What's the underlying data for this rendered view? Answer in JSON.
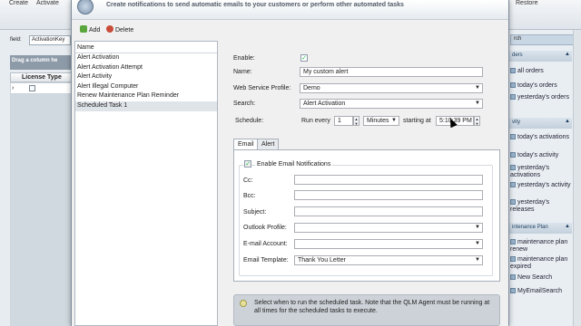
{
  "app_toolbar": {
    "create_label": "Create",
    "activate_label": "Activate",
    "restore_label": "Restore"
  },
  "left_grid": {
    "field_label": "field:",
    "field_value": "ActivationKey",
    "group_hint": "Drag a column he",
    "column_header": "License Type"
  },
  "dialog": {
    "header_text": "Create notifications to send automatic emails to your customers or perform other automated tasks",
    "add_label": "Add",
    "delete_label": "Delete",
    "list_header": "Name",
    "tasks": [
      "Alert Activation",
      "Alert Activation Attempt",
      "Alert Activity",
      "Alert Illegal Computer",
      "Renew Maintenance Plan Reminder",
      "Scheduled Task 1"
    ],
    "form": {
      "enable_label": "Enable:",
      "name_label": "Name:",
      "name_value": "My custom alert",
      "profile_label": "Web Service Profile:",
      "profile_value": "Demo",
      "search_label": "Search:",
      "search_value": "Alert Activation",
      "schedule_label": "Schedule:",
      "run_every_label": "Run every",
      "run_every_value": "1",
      "unit_value": "Minutes",
      "starting_at_label": "starting at",
      "time_value": "5:10:39 PM"
    },
    "tabs": [
      "Email",
      "Alert"
    ],
    "email": {
      "enable_label": "Enable Email Notifications",
      "cc_label": "Cc:",
      "bcc_label": "Bcc:",
      "subject_label": "Subject:",
      "outlook_label": "Outlook Profile:",
      "account_label": "E-mail Account:",
      "template_label": "Email Template:",
      "template_value": "Thank You Letter"
    },
    "info_text": "Select when to run the scheduled task. Note that the QLM Agent must be running at all times for the scheduled tasks to execute."
  },
  "right_panel": {
    "search_label": "rch",
    "orders_header": "ders",
    "orders_items": [
      "all orders",
      "today's orders",
      "yesterday's orders"
    ],
    "activity_header": "vity",
    "activity_items": [
      "today's activations",
      "today's activity",
      "yesterday's activations",
      "yesterday's activity",
      "yesterday's releases"
    ],
    "maintenance_header": "intenance Plan",
    "maintenance_items": [
      "maintenance plan renew",
      "maintenance plan expired",
      "New Search",
      "MyEmailSearch"
    ]
  }
}
